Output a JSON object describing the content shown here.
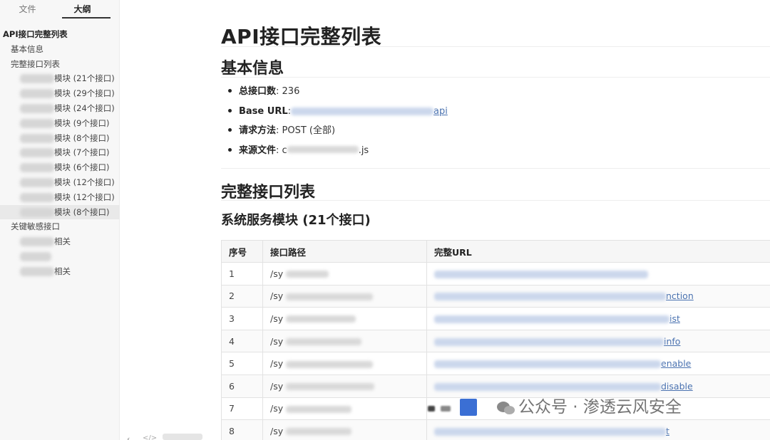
{
  "sidebar": {
    "tabs": [
      {
        "label": "文件"
      },
      {
        "label": "大纲"
      }
    ],
    "outline": [
      {
        "label": "API接口完整列表",
        "level": 1
      },
      {
        "label": "基本信息",
        "level": 2
      },
      {
        "label": "完整接口列表",
        "level": 2
      },
      {
        "label": "模块 (21个接口)",
        "level": 3
      },
      {
        "label": "模块 (29个接口)",
        "level": 3
      },
      {
        "label": "模块 (24个接口)",
        "level": 3
      },
      {
        "label": "模块 (9个接口)",
        "level": 3
      },
      {
        "label": "模块 (8个接口)",
        "level": 3
      },
      {
        "label": "模块 (7个接口)",
        "level": 3
      },
      {
        "label": "模块 (6个接口)",
        "level": 3
      },
      {
        "label": "模块 (12个接口)",
        "level": 3
      },
      {
        "label": "模块 (12个接口)",
        "level": 3
      },
      {
        "label": "模块 (8个接口)",
        "level": 3
      },
      {
        "label": "关键敏感接口",
        "level": 2
      },
      {
        "label": "相关",
        "level": 3
      },
      {
        "label": "",
        "level": 3
      },
      {
        "label": "相关",
        "level": 3
      }
    ]
  },
  "doc": {
    "title": "API接口完整列表",
    "basic_heading": "基本信息",
    "info": [
      {
        "key": "总接口数",
        "value": ": 236"
      },
      {
        "key": "Base URL",
        "value": ": ",
        "link_tail": "api"
      },
      {
        "key": "请求方法",
        "value": ": POST (全部)"
      },
      {
        "key": "来源文件",
        "value": ": c",
        "tail": ".js"
      }
    ],
    "list_heading": "完整接口列表",
    "module_heading": "系统服务模块 (21个接口)",
    "table": {
      "headers": [
        "序号",
        "接口路径",
        "完整URL"
      ],
      "rows": [
        {
          "no": "1",
          "path": "/sy",
          "url_tail": ""
        },
        {
          "no": "2",
          "path": "/sy",
          "url_tail": "nction"
        },
        {
          "no": "3",
          "path": "/sy",
          "url_tail": "ist"
        },
        {
          "no": "4",
          "path": "/sy",
          "url_tail": "info"
        },
        {
          "no": "5",
          "path": "/sy",
          "url_tail": "enable"
        },
        {
          "no": "6",
          "path": "/sy",
          "url_tail": "disable"
        },
        {
          "no": "7",
          "path": "/sy",
          "url_tail": ""
        },
        {
          "no": "8",
          "path": "/sy",
          "url_tail": "t"
        }
      ]
    }
  },
  "watermark": {
    "text": "公众号 · 渗透云风安全"
  }
}
